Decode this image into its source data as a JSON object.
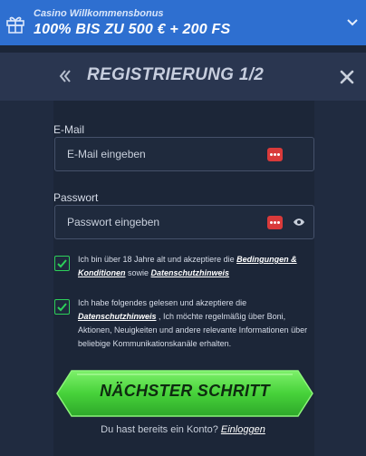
{
  "promo": {
    "subtitle": "Casino Willkommensbonus",
    "title": "100% BIS ZU 500 € + 200 FS"
  },
  "modal": {
    "title": "REGISTRIERUNG 1/2"
  },
  "form": {
    "email_label": "E-Mail",
    "email_placeholder": "E-Mail eingeben",
    "password_label": "Passwort",
    "password_placeholder": "Passwort eingeben",
    "consent1": {
      "checked": true,
      "text_before": "Ich bin über 18 Jahre alt und akzeptiere die ",
      "link1": "Bedingungen & Konditionen",
      "text_middle": " sowie ",
      "link2": "Datenschutzhinweis"
    },
    "consent2": {
      "checked": true,
      "text_before": "Ich habe folgendes gelesen und akzeptiere die ",
      "link": "Datenschutzhinweis",
      "text_after": " , Ich möchte regelmäßig über Boni, Aktionen, Neuigkeiten und andere relevante Informationen über beliebige Kommunikationskanäle erhalten."
    },
    "submit_label": "NÄCHSTER SCHRITT",
    "login_prompt": "Du hast bereits ein Konto? ",
    "login_link": "Einloggen"
  },
  "colors": {
    "promo_bg": "#2e6fd0",
    "accent_green": "#2dd05a",
    "password_badge": "#d93a3a"
  }
}
